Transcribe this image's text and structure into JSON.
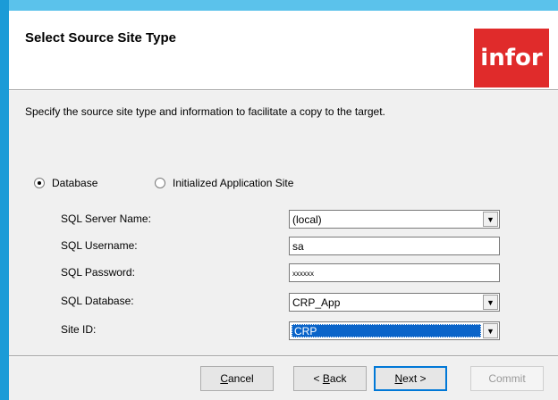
{
  "header": {
    "title": "Select Source Site Type",
    "logo_text": "infor"
  },
  "description": "Specify the source site type and information to facilitate a copy to the target.",
  "source_type": {
    "options": [
      {
        "label": "Database",
        "checked": true
      },
      {
        "label": "Initialized Application Site",
        "checked": false
      }
    ]
  },
  "fields": {
    "server_name": {
      "label": "SQL Server Name:",
      "value": "(local)"
    },
    "username": {
      "label": "SQL Username:",
      "value": "sa"
    },
    "password": {
      "label": "SQL Password:",
      "value": "xxxxxx"
    },
    "database": {
      "label": "SQL Database:",
      "value": "CRP_App"
    },
    "site_id": {
      "label": "Site ID:",
      "value": "CRP"
    }
  },
  "buttons": {
    "cancel": {
      "pre": "",
      "key": "C",
      "post": "ancel"
    },
    "back": {
      "pre": "< ",
      "key": "B",
      "post": "ack"
    },
    "next": {
      "pre": "",
      "key": "N",
      "post": "ext >"
    },
    "commit": "Commit"
  },
  "colors": {
    "accent_blue": "#1b9bd7",
    "logo_red": "#e02b2b",
    "selection": "#0a64c9"
  }
}
